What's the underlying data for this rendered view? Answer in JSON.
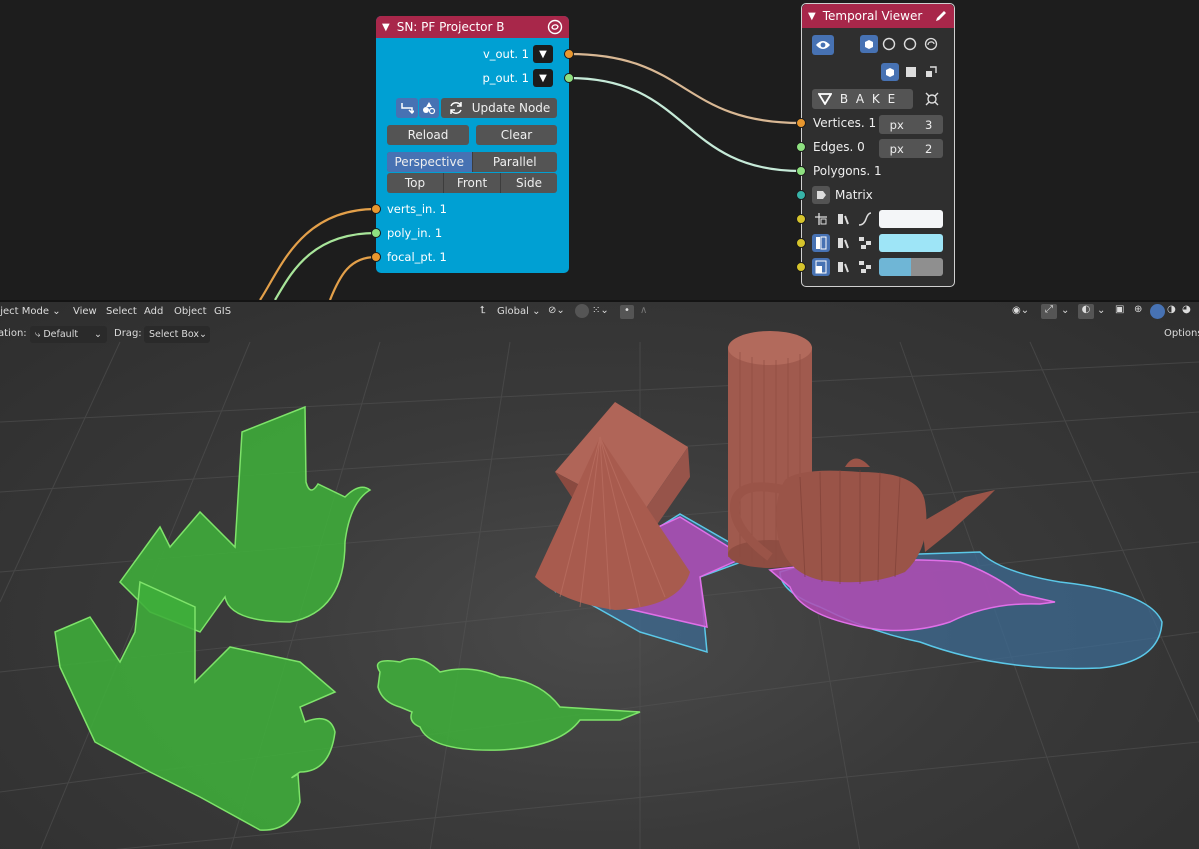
{
  "projector_node": {
    "title": "SN: PF Projector B",
    "outputs": [
      {
        "label": "v_out. 1",
        "type": "vertices"
      },
      {
        "label": "p_out. 1",
        "type": "polygons"
      }
    ],
    "update_label": "Update Node",
    "reload_label": "Reload",
    "clear_label": "Clear",
    "projection_modes": [
      "Perspective",
      "Parallel"
    ],
    "active_mode": "Perspective",
    "view_buttons": [
      "Top",
      "Front",
      "Side"
    ],
    "inputs": [
      {
        "label": "verts_in. 1"
      },
      {
        "label": "poly_in. 1"
      },
      {
        "label": "focal_pt. 1"
      }
    ]
  },
  "viewer_node": {
    "title": "Temporal Viewer",
    "bake_label": "B A K E",
    "rows": [
      {
        "label": "Vertices. 1",
        "unit": "px",
        "value": "3"
      },
      {
        "label": "Edges. 0",
        "unit": "px",
        "value": "2"
      },
      {
        "label": "Polygons. 1"
      },
      {
        "label": "Matrix"
      }
    ],
    "colors": {
      "vertex": "#f4f6f8",
      "edge": "#9ee5f7",
      "face": "#6fb6d6"
    }
  },
  "viewport_header": {
    "mode": "Object Mode",
    "menus": [
      "View",
      "Select",
      "Add",
      "Object",
      "GIS"
    ],
    "orientation": "Global",
    "options_label": "Options"
  },
  "viewport_subheader": {
    "orientation_label": "ation:",
    "orientation_value": "Default",
    "drag_label": "Drag:",
    "drag_value": "Select Box"
  },
  "scene": {
    "objects": [
      "cube",
      "cone",
      "cylinder",
      "teapot"
    ],
    "projection_fill": "#44bb44",
    "mesh_color": "#a05a4e",
    "shadow_fill": "#c04ec0",
    "outline_color": "#5bc8e8"
  }
}
